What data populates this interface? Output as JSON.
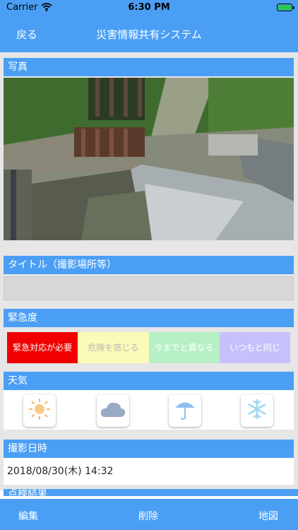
{
  "status_bar": {
    "carrier": "Carrier",
    "time": "6:30 PM",
    "icons": [
      "wifi-icon",
      "battery-charging-icon"
    ]
  },
  "nav": {
    "back_label": "戻る",
    "title": "災害情報共有システム"
  },
  "sections": {
    "photo": "写真",
    "title_field": "タイトル（撮影場所等）",
    "urgency": "緊急度",
    "weather": "天気",
    "datetime": "撮影日時",
    "inspection": "点検結果"
  },
  "title_input": {
    "value": "",
    "placeholder": ""
  },
  "urgency_options": [
    {
      "label": "緊急対応が必要",
      "bg": "#f00000",
      "color": "#ffffff"
    },
    {
      "label": "危険を感じる",
      "bg": "#fbfbb8",
      "color": "#b9b9b9"
    },
    {
      "label": "今までと異なる",
      "bg": "#b6f0c4",
      "color": "#ffffff"
    },
    {
      "label": "いつもと同じ",
      "bg": "#c6c1fb",
      "color": "#ffffff"
    }
  ],
  "weather_options": [
    {
      "name": "sunny-icon"
    },
    {
      "name": "cloudy-icon"
    },
    {
      "name": "rain-umbrella-icon"
    },
    {
      "name": "snow-icon"
    }
  ],
  "datetime_value": "2018/08/30(木) 14:32",
  "toolbar": {
    "edit_label": "編集",
    "delete_label": "削除",
    "map_label": "地図"
  },
  "colors": {
    "accent": "#4a9ff5",
    "background": "#e6e6e6"
  }
}
